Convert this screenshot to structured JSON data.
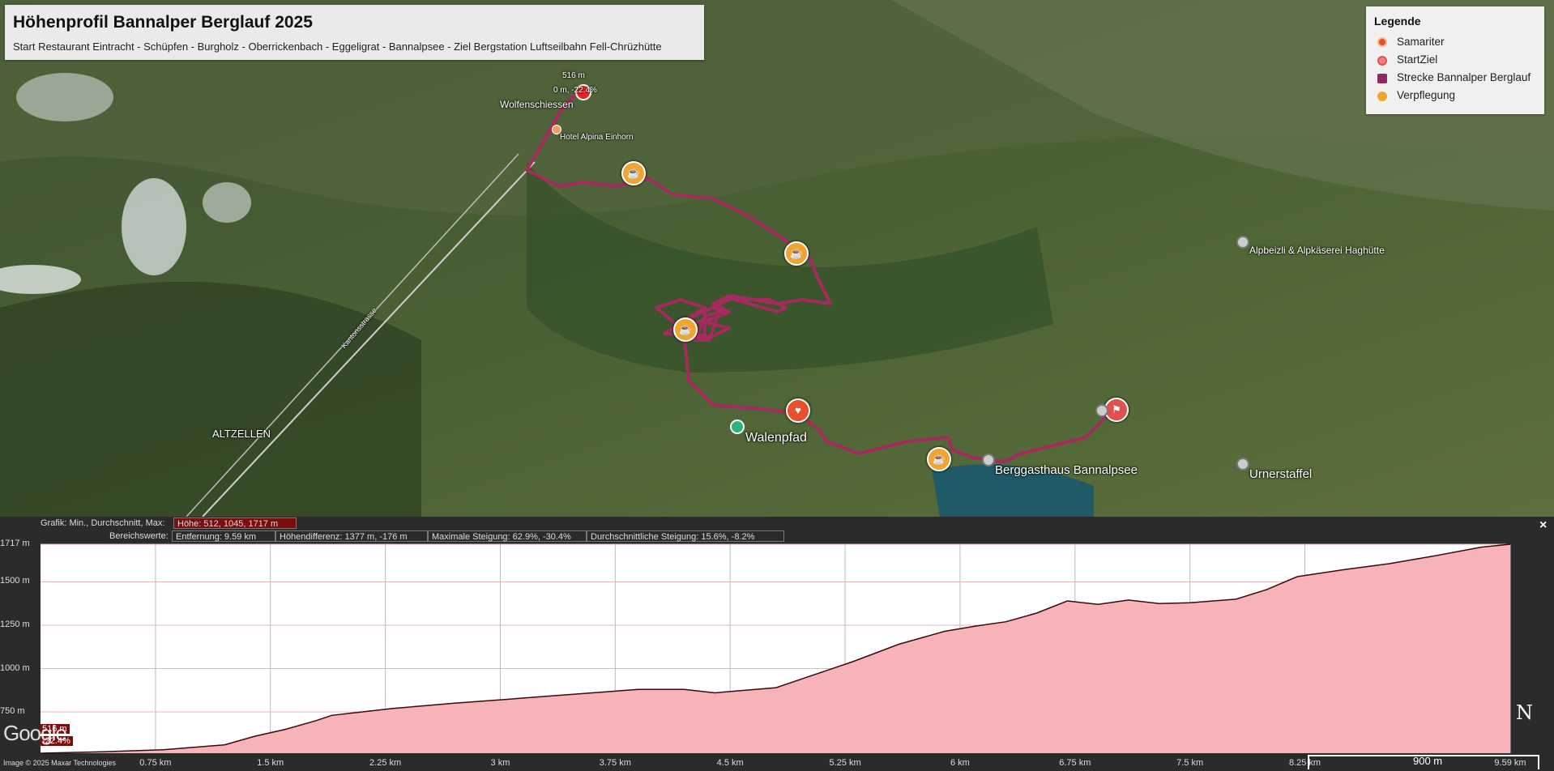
{
  "title": "Höhenprofil Bannalper Berglauf 2025",
  "subtitle": "Start Restaurant Eintracht - Schüpfen - Burgholz - Oberrickenbach - Eggeligrat - Bannalpsee - Ziel Bergstation Luftseilbahn Fell-Chrüzhütte",
  "legend": {
    "heading": "Legende",
    "items": [
      {
        "label": "Samariter",
        "color": "#e8502d"
      },
      {
        "label": "StartZiel",
        "color": "#e05050"
      },
      {
        "label": "Strecke Bannalper Berglauf",
        "color": "#8e2a5e"
      },
      {
        "label": "Verpflegung",
        "color": "#f0a531"
      }
    ]
  },
  "map_labels": {
    "wolfenschiessen": "Wolfenschiessen",
    "hotel": "Hotel Alpina Einhorn",
    "marker_height": "516 m",
    "marker_grade": "0 m, -22.4%",
    "walenpfad": "Walenpfad",
    "altzellen": "ALTZELLEN",
    "kantonsstrasse": "Kantonsstrasse",
    "alpbeizli": "Alpbeizli & Alpkäserei Haghütte",
    "berggasthaus": "Berggasthaus Bannalpsee",
    "urnerstaffel": "Urnerstaffel"
  },
  "profile_header": {
    "graph_label": "Grafik: Min., Durchschnitt, Max:",
    "graph_value": "Höhe: 512, 1045, 1717 m",
    "range_label": "Bereichswerte:",
    "distance": "Entfernung: 9.59 km",
    "elev_diff": "Höhendifferenz: 1377 m, -176 m",
    "max_slope": "Maximale Steigung: 62.9%, -30.4%",
    "avg_slope": "Durchschnittliche Steigung: 15.6%, -8.2%"
  },
  "close_label": "×",
  "cursor_readout": {
    "height": "516 m",
    "grade": "-22.4%"
  },
  "google_earth": "Google Earth",
  "credit": "Image © 2025 Maxar Technologies",
  "north": "N",
  "scale_label": "900 m",
  "chart_data": {
    "type": "area",
    "title": "",
    "xlabel": "",
    "ylabel": "",
    "xlim": [
      0,
      9.59
    ],
    "ylim": [
      512,
      1717
    ],
    "yticks": [
      {
        "label": "1717 m",
        "v": 1717
      },
      {
        "label": "1500 m",
        "v": 1500
      },
      {
        "label": "1250 m",
        "v": 1250
      },
      {
        "label": "1000 m",
        "v": 1000
      },
      {
        "label": "750 m",
        "v": 750
      }
    ],
    "xticks": [
      {
        "label": "0.75 km",
        "v": 0.75
      },
      {
        "label": "1.5 km",
        "v": 1.5
      },
      {
        "label": "2.25 km",
        "v": 2.25
      },
      {
        "label": "3 km",
        "v": 3
      },
      {
        "label": "3.75 km",
        "v": 3.75
      },
      {
        "label": "4.5 km",
        "v": 4.5
      },
      {
        "label": "5.25 km",
        "v": 5.25
      },
      {
        "label": "6 km",
        "v": 6
      },
      {
        "label": "6.75 km",
        "v": 6.75
      },
      {
        "label": "7.5 km",
        "v": 7.5
      },
      {
        "label": "8.25 km",
        "v": 8.25
      },
      {
        "label": "9.59 km",
        "v": 9.59
      }
    ],
    "grid": true,
    "fill_color": "#f7b3b8",
    "line_color": "#3a0a0a",
    "x": [
      0,
      0.4,
      0.8,
      1.2,
      1.4,
      1.6,
      1.8,
      1.9,
      2.1,
      2.3,
      2.5,
      2.7,
      3.0,
      3.3,
      3.6,
      3.9,
      4.2,
      4.4,
      4.6,
      4.8,
      5.0,
      5.3,
      5.6,
      5.9,
      6.1,
      6.3,
      6.5,
      6.7,
      6.9,
      7.1,
      7.3,
      7.5,
      7.8,
      8.0,
      8.2,
      8.5,
      8.8,
      9.1,
      9.4,
      9.59
    ],
    "y": [
      512,
      520,
      532,
      560,
      610,
      650,
      700,
      730,
      750,
      770,
      785,
      800,
      820,
      840,
      860,
      880,
      880,
      860,
      875,
      890,
      950,
      1040,
      1140,
      1215,
      1245,
      1270,
      1320,
      1390,
      1370,
      1395,
      1375,
      1380,
      1400,
      1455,
      1530,
      1570,
      1605,
      1650,
      1700,
      1717
    ]
  }
}
